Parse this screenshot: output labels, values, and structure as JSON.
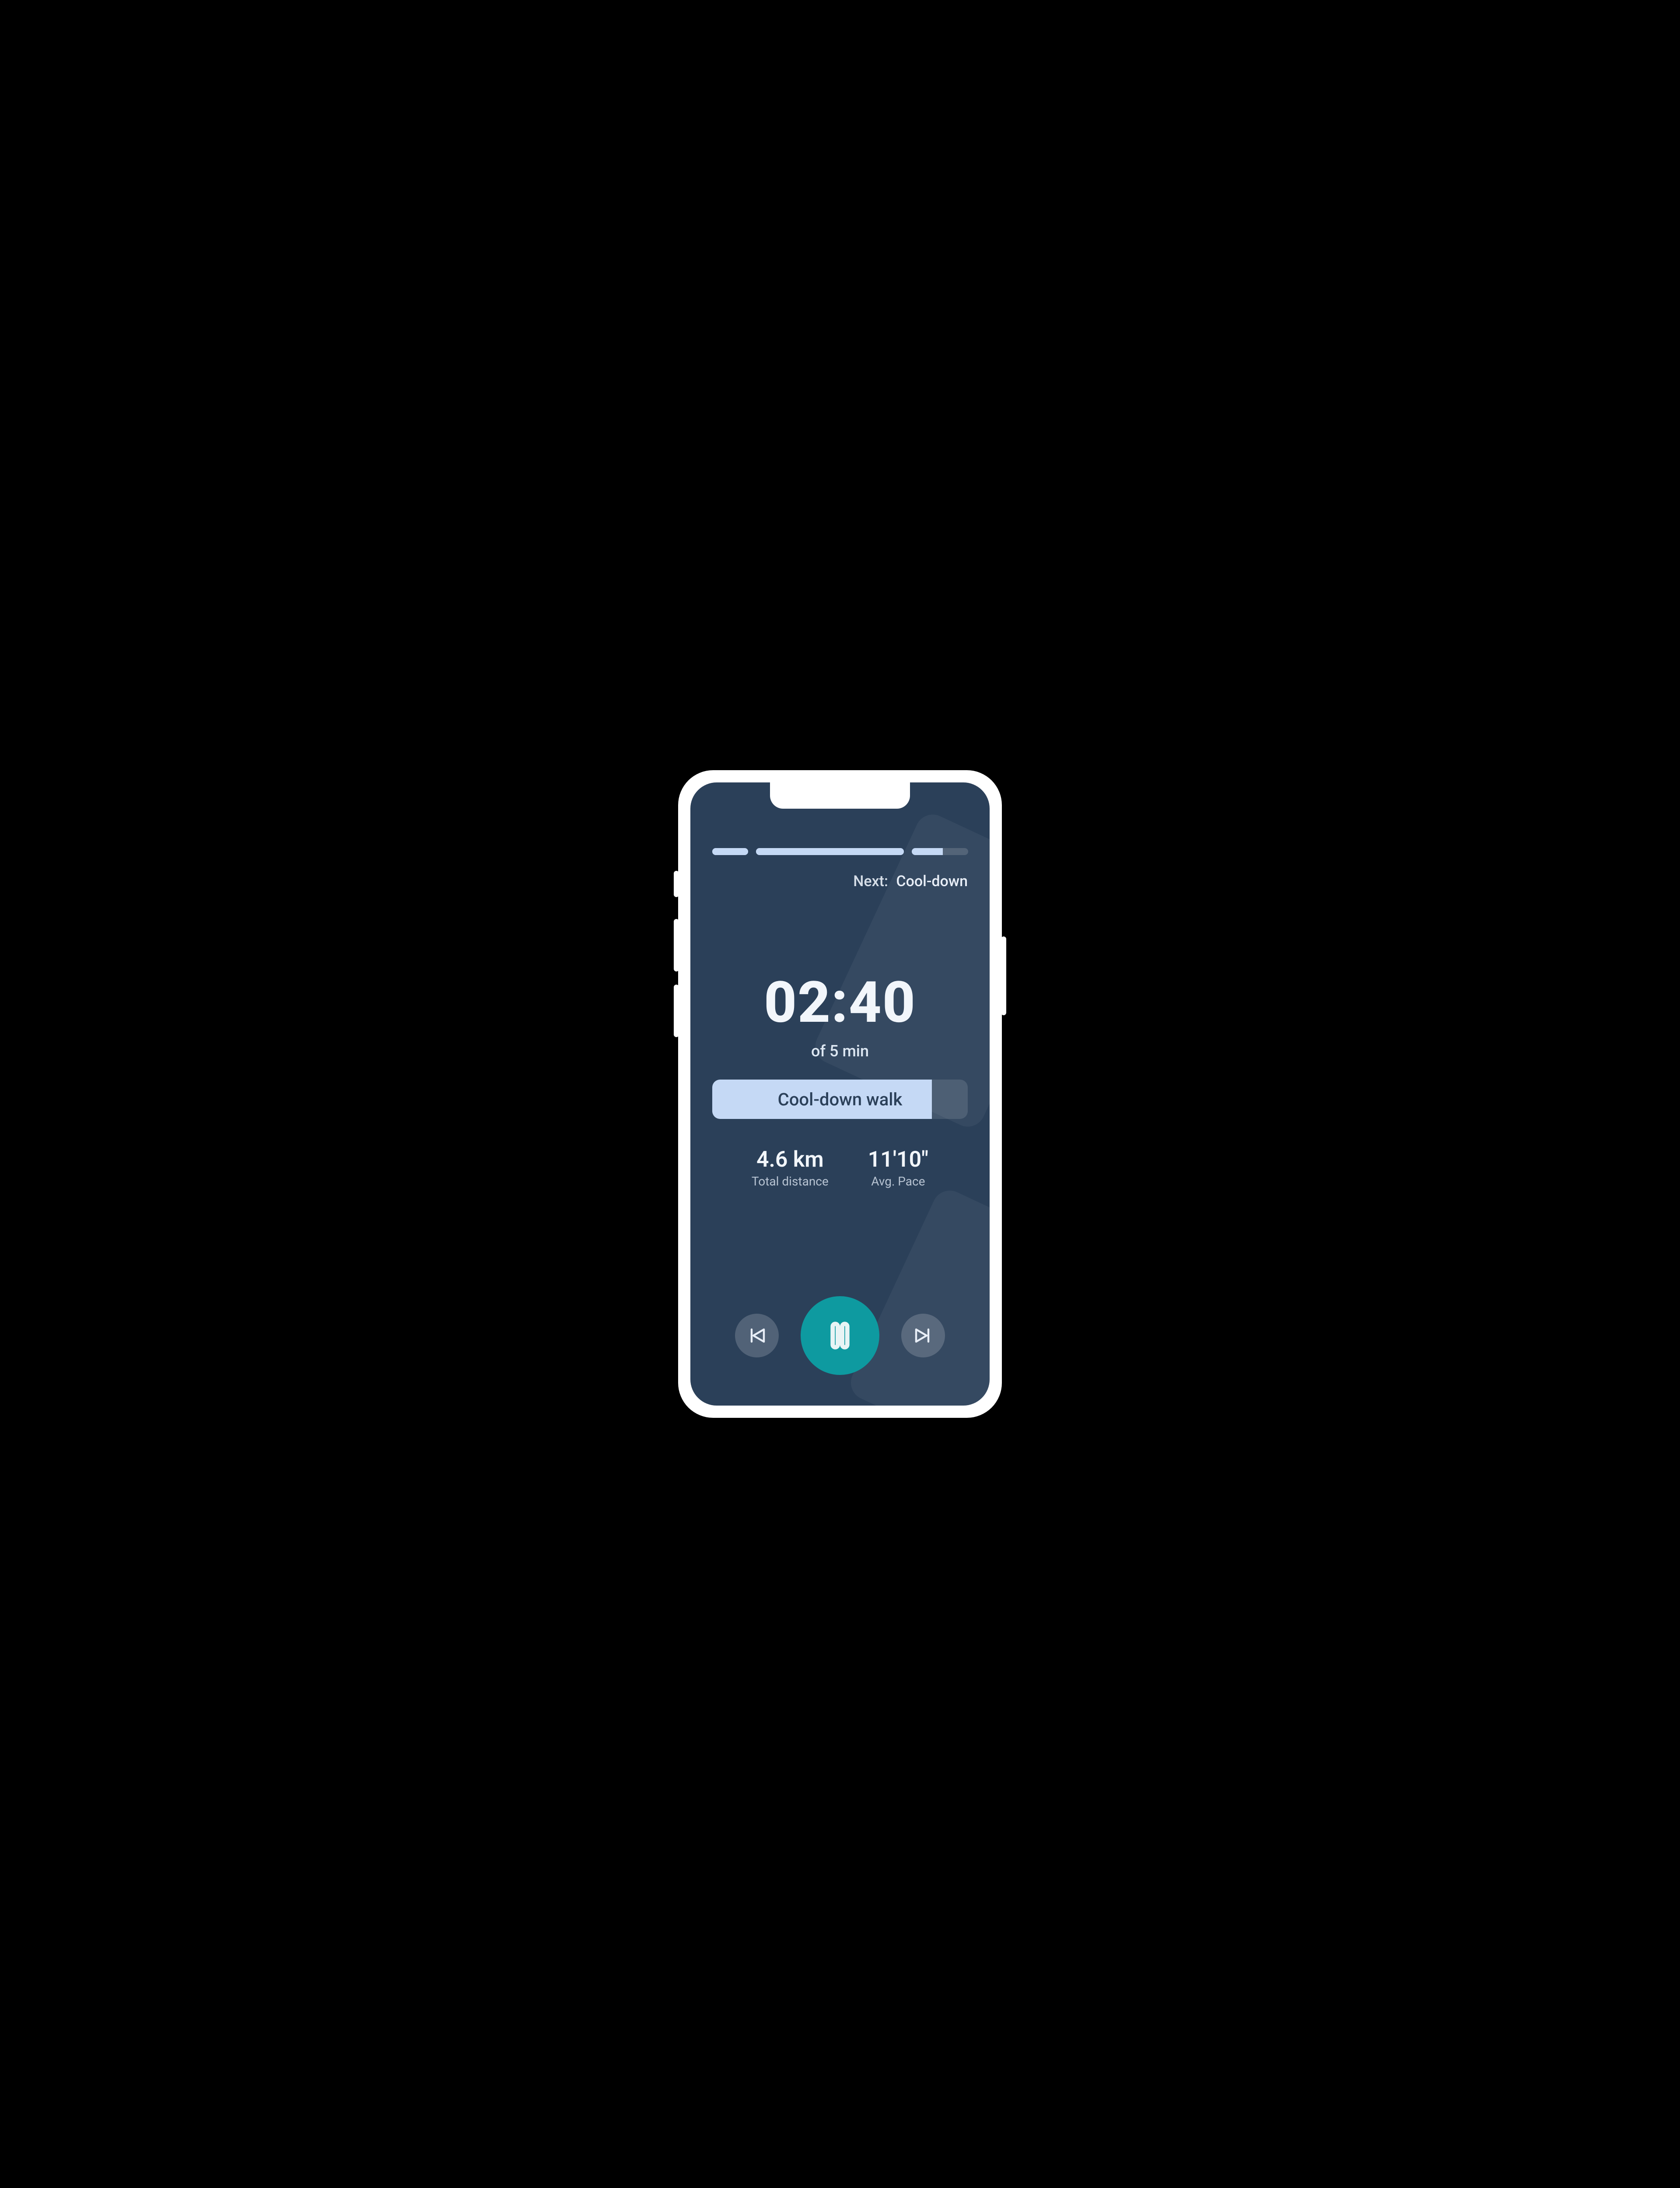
{
  "segments": [
    {
      "widthPct": 14,
      "fillPct": 100
    },
    {
      "widthPct": 58,
      "fillPct": 100
    },
    {
      "widthPct": 22,
      "fillPct": 55
    }
  ],
  "next": {
    "label": "Next:",
    "value": "Cool-down"
  },
  "timer": {
    "elapsed": "02:40",
    "ofTotal": "of 5 min"
  },
  "activity": {
    "label": "Cool-down walk",
    "fillPct": 86
  },
  "stats": {
    "distance": {
      "value": "4.6 km",
      "label": "Total distance"
    },
    "pace": {
      "value": "11'10\"",
      "label": "Avg. Pace"
    }
  },
  "colors": {
    "screenBg": "#2b4059",
    "segmentFill": "#c5d9f5",
    "accent": "#0e9aa0"
  }
}
